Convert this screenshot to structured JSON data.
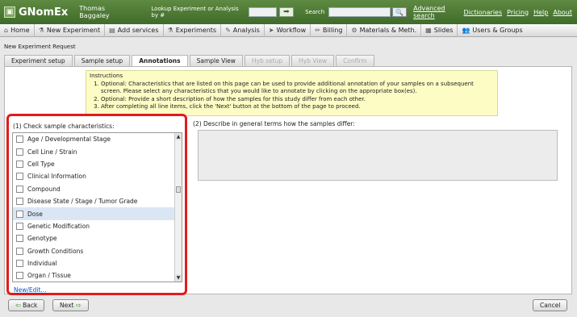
{
  "header": {
    "logo_glyph": "▣",
    "app_name": "GNomEx",
    "user": "Thomas Baggaley",
    "lookup_label": "Lookup Experiment or Analysis by #",
    "go_icon": "➡",
    "search_label": "Search",
    "search_icon": "🔍",
    "advanced_search": "Advanced search",
    "links": [
      "Dictionaries",
      "Pricing",
      "Help",
      "About"
    ]
  },
  "menu": [
    {
      "icon": "⌂",
      "label": "Home"
    },
    {
      "icon": "⚗",
      "label": "New Experiment"
    },
    {
      "icon": "▤",
      "label": "Add services"
    },
    {
      "icon": "⚗",
      "label": "Experiments"
    },
    {
      "icon": "✎",
      "label": "Analysis"
    },
    {
      "icon": "➤",
      "label": "Workflow"
    },
    {
      "icon": "✏",
      "label": "Billing"
    },
    {
      "icon": "⚙",
      "label": "Materials & Meth."
    },
    {
      "icon": "▦",
      "label": "Slides"
    },
    {
      "icon": "👥",
      "label": "Users & Groups"
    }
  ],
  "page": {
    "title": "New Experiment Request",
    "tabs": [
      {
        "label": "Experiment setup",
        "state": "normal"
      },
      {
        "label": "Sample setup",
        "state": "normal"
      },
      {
        "label": "Annotations",
        "state": "active"
      },
      {
        "label": "Sample View",
        "state": "normal"
      },
      {
        "label": "Hyb setup",
        "state": "disabled"
      },
      {
        "label": "Hyb View",
        "state": "disabled"
      },
      {
        "label": "Confirm",
        "state": "disabled"
      }
    ]
  },
  "instructions": {
    "heading": "Instructions",
    "items": [
      "Optional: Characteristics that are listed on this page can be used to provide additional annotation of your samples on a subsequent screen. Please select any characteristics that you would like to annotate by clicking on the appropriate box(es).",
      "Optional: Provide a short description of how the samples for this study differ from each other.",
      "After completing all line items, click the 'Next' button at the bottom of the page to proceed."
    ]
  },
  "characteristics": {
    "label": "(1) Check sample characteristics:",
    "items": [
      "Age / Developmental Stage",
      "Cell Line / Strain",
      "Cell Type",
      "Clinical Information",
      "Compound",
      "Disease State / Stage / Tumor Grade",
      "Dose",
      "Genetic Modification",
      "Genotype",
      "Growth Conditions",
      "Individual",
      "Organ / Tissue"
    ],
    "selected_index": 6,
    "scroll_up": "▲",
    "scroll_down": "▼",
    "new_edit": "New/Edit..."
  },
  "description": {
    "label": "(2) Describe in general terms how the samples differ:",
    "value": ""
  },
  "footer": {
    "back": "Back",
    "next": "Next",
    "cancel": "Cancel",
    "back_arrow": "⇦",
    "next_arrow": "⇨"
  },
  "colors": {
    "header_green": "#4a7a33",
    "highlight_red": "#e01c1c",
    "instructions_bg": "#fcfcc4",
    "selected_row": "#dbe6f5"
  }
}
